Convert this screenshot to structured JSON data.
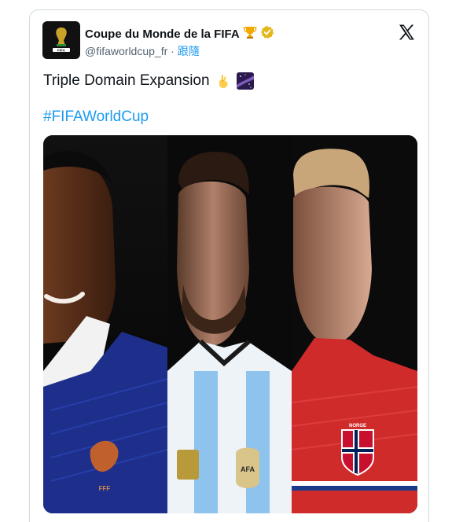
{
  "account": {
    "display_name": "Coupe du Monde de la FIFA",
    "handle": "@fifaworldcup_fr",
    "separator": " · ",
    "follow_label": "跟隨"
  },
  "tweet": {
    "text": "Triple Domain Expansion",
    "hashtag": "#FIFAWorldCup"
  },
  "icons": {
    "trophy": "trophy-icon",
    "verified": "verified-badge-icon",
    "close": "x-logo-icon",
    "fingers_crossed": "crossed-fingers-emoji",
    "galaxy": "milky-way-emoji"
  },
  "media": {
    "description_badges": [
      "FFF",
      "AFA",
      "NORGE"
    ]
  },
  "colors": {
    "link": "#1d9bf0",
    "verified": "#e2b719",
    "text": "#0f1419",
    "muted": "#536471",
    "border": "#cfd9de"
  }
}
